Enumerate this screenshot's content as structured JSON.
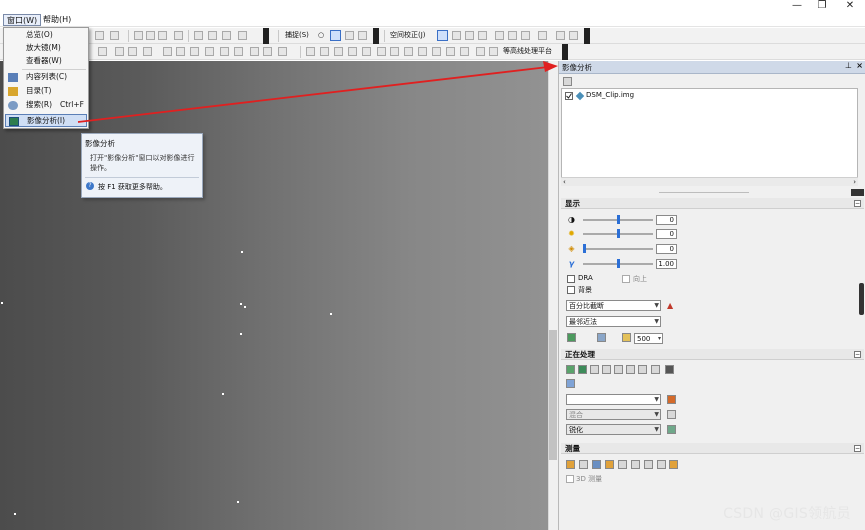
{
  "menubar": {
    "window_menu": "窗口(W)",
    "help_menu": "帮助(H)"
  },
  "window_controls": {
    "minimize": "—",
    "maximize": "❐",
    "close": "✕"
  },
  "toolbar": {
    "snapping_label": "捕捉(S)",
    "georeferencing_label": "空间校正(J)",
    "contour_platform_label": "等高线处理平台"
  },
  "window_menu_items": [
    {
      "label": "总览(O)",
      "shortcut": ""
    },
    {
      "label": "放大镜(M)",
      "shortcut": ""
    },
    {
      "label": "查看器(W)",
      "shortcut": ""
    },
    {
      "label": "内容列表(C)",
      "shortcut": ""
    },
    {
      "label": "目录(T)",
      "shortcut": ""
    },
    {
      "label": "搜索(R)",
      "shortcut": "Ctrl+F"
    },
    {
      "label": "影像分析(I)",
      "shortcut": ""
    }
  ],
  "tooltip": {
    "title": "影像分析",
    "body_line1": "打开\"影像分析\"窗口以对影像进行",
    "body_line2": "操作。",
    "help": "按 F1 获取更多帮助。"
  },
  "panel": {
    "title": "影像分析",
    "pin_icon": "pin-icon",
    "layer_name": "DSM_Clip.img",
    "display": {
      "header": "显示",
      "sliders": [
        {
          "name": "contrast",
          "value": "0",
          "level": 0.5
        },
        {
          "name": "brightness",
          "value": "0",
          "level": 0.5
        },
        {
          "name": "transparency",
          "value": "0",
          "level": 0.0
        },
        {
          "name": "gamma",
          "value": "1.00",
          "level": 0.5
        }
      ],
      "dra_label": "DRA",
      "dra_checked": false,
      "up_label": "向上",
      "background_label": "背景",
      "background_checked": false,
      "stretch_value": "百分比截断",
      "resample_value": "最邻近法",
      "zoom_value": "500"
    },
    "processing": {
      "header": "正在处理",
      "combo1_value": "",
      "blend_value": "混合",
      "sharpen_value": "锐化"
    },
    "measure": {
      "header": "测量",
      "measure_3d_label": "3D 测量",
      "measure_3d_checked": false
    }
  },
  "watermark": "CSDN @GIS领航员",
  "colors": {
    "arrow": "#e02020",
    "panel_header": "#cfd9e8",
    "selection": "#d0dff5"
  }
}
